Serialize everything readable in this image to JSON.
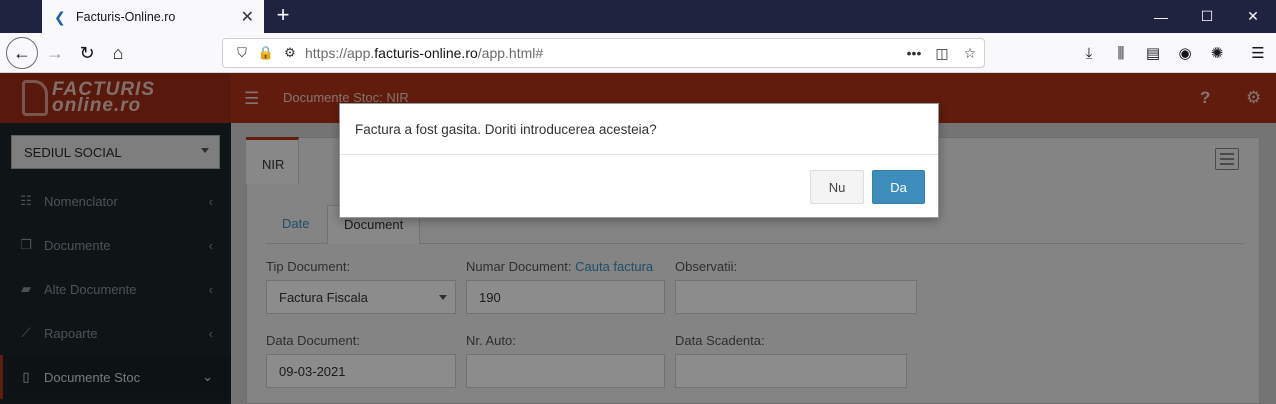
{
  "browser": {
    "tab_title": "Facturis-Online.ro",
    "tab_close": "✕",
    "new_tab": "+",
    "url_prefix": "https://app.",
    "url_domain": "facturis-online.ro",
    "url_suffix": "/app.html#",
    "url_more": "•••"
  },
  "app": {
    "logo_line1": "FACTURIS",
    "logo_line2": "online.ro",
    "breadcrumb": "Documente Stoc: NIR"
  },
  "sidebar": {
    "company": "SEDIUL SOCIAL",
    "items": [
      {
        "label": "Nomenclator",
        "icon": "list-icon"
      },
      {
        "label": "Documente",
        "icon": "copy-icon"
      },
      {
        "label": "Alte Documente",
        "icon": "folder-icon"
      },
      {
        "label": "Rapoarte",
        "icon": "chart-line-icon"
      },
      {
        "label": "Documente Stoc",
        "icon": "file-icon"
      }
    ]
  },
  "page": {
    "main_tab": "NIR",
    "subtabs": [
      "Date",
      "Document"
    ]
  },
  "form": {
    "tip_document_label": "Tip Document:",
    "tip_document_value": "Factura Fiscala",
    "numar_document_label": "Numar Document:",
    "cauta_factura_link": "Cauta factura",
    "numar_document_value": "190",
    "observatii_label": "Observatii:",
    "observatii_value": "",
    "data_document_label": "Data Document:",
    "data_document_value": "09-03-2021",
    "nr_auto_label": "Nr. Auto:",
    "nr_auto_value": "",
    "data_scadenta_label": "Data Scadenta:",
    "data_scadenta_value": ""
  },
  "modal": {
    "message": "Factura a fost gasita. Doriti introducerea acesteia?",
    "no_label": "Nu",
    "yes_label": "Da"
  },
  "colors": {
    "brand_red": "#b33319",
    "sidebar_bg": "#1c262b",
    "primary_blue": "#3c8dbc"
  }
}
